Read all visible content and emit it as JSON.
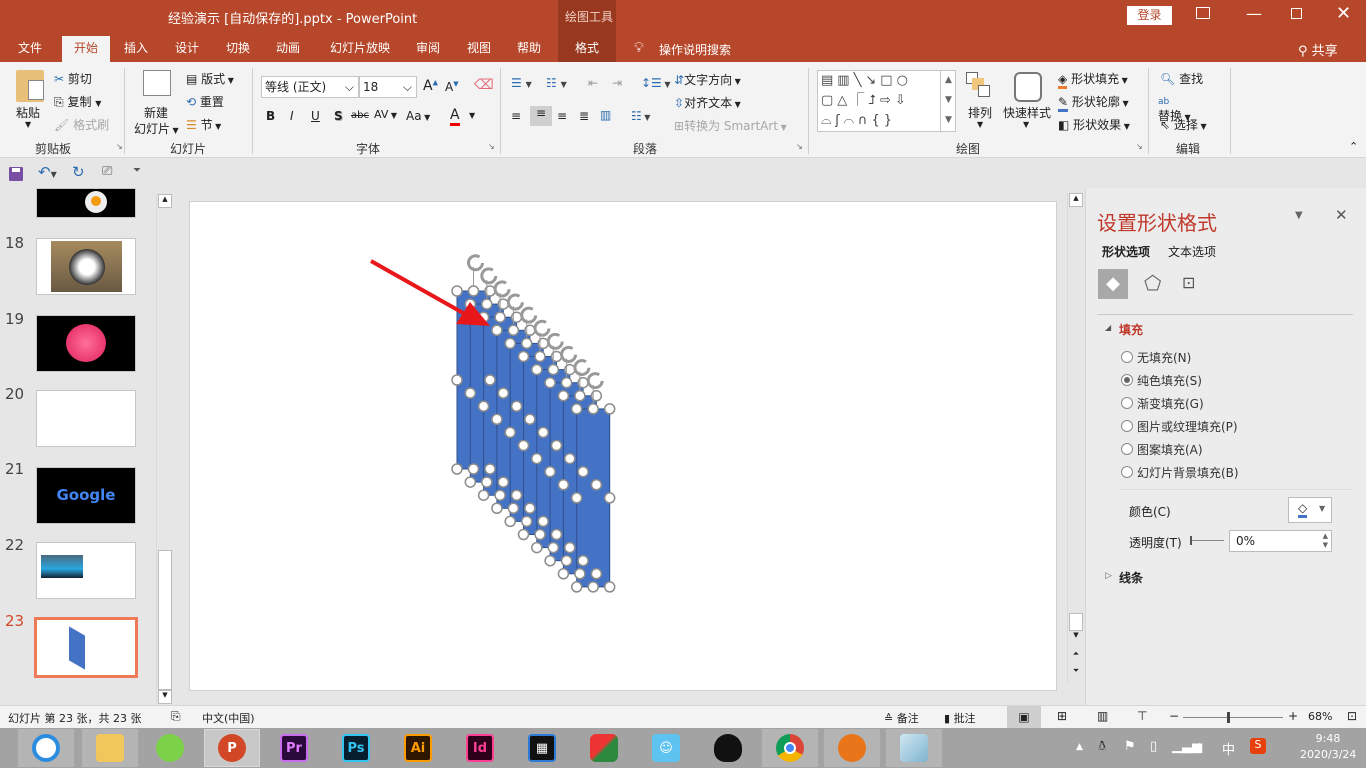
{
  "titlebar": {
    "title": "经验演示 [自动保存的].pptx  -  PowerPoint",
    "context_group": "绘图工具",
    "login": "登录",
    "share": "共享"
  },
  "tabs": [
    "文件",
    "开始",
    "插入",
    "设计",
    "切换",
    "动画",
    "幻灯片放映",
    "审阅",
    "视图",
    "帮助",
    "格式"
  ],
  "tell_me": "操作说明搜索",
  "ribbon": {
    "clipboard": {
      "label": "剪贴板",
      "paste": "粘贴",
      "cut": "剪切",
      "copy": "复制",
      "format_painter": "格式刷"
    },
    "slides": {
      "label": "幻灯片",
      "new_slide_1": "新建",
      "new_slide_2": "幻灯片",
      "layout": "版式",
      "reset": "重置",
      "section": "节"
    },
    "font": {
      "label": "字体",
      "font_name": "等线 (正文)",
      "font_size": "18",
      "bold": "B",
      "italic": "I",
      "underline": "U",
      "shadow": "S",
      "strike": "abc",
      "spacing": "AV",
      "case": "Aa",
      "color": "A"
    },
    "paragraph": {
      "label": "段落",
      "text_direction": "文字方向",
      "align_text": "对齐文本",
      "smartart": "转换为 SmartArt"
    },
    "drawing": {
      "label": "绘图",
      "arrange": "排列",
      "quick_styles": "快速样式",
      "shape_fill": "形状填充",
      "shape_outline": "形状轮廓",
      "shape_effects": "形状效果"
    },
    "editing": {
      "label": "编辑",
      "find": "查找",
      "replace": "替换",
      "select": "选择"
    }
  },
  "thumbnails": [
    {
      "num": "18"
    },
    {
      "num": "19"
    },
    {
      "num": "20"
    },
    {
      "num": "21",
      "text": "Google"
    },
    {
      "num": "22"
    },
    {
      "num": "23",
      "selected": true
    }
  ],
  "pane": {
    "title": "设置形状格式",
    "tab_shape": "形状选项",
    "tab_text": "文本选项",
    "section_fill": "填充",
    "options": [
      "无填充(N)",
      "纯色填充(S)",
      "渐变填充(G)",
      "图片或纹理填充(P)",
      "图案填充(A)",
      "幻灯片背景填充(B)"
    ],
    "selected_option": 1,
    "color_label": "颜色(C)",
    "transparency_label": "透明度(T)",
    "transparency_value": "0%",
    "section_line": "线条"
  },
  "status": {
    "slide_info": "幻灯片 第 23 张，共 23 张",
    "language": "中文(中国)",
    "notes": "备注",
    "comments": "批注",
    "zoom": "68%",
    "zoom_fraction": 0.45
  },
  "taskbar": {
    "apps": [
      "360浏览器",
      "文件资源管理器",
      "微信",
      "PowerPoint",
      "Pr",
      "Ps",
      "Ai",
      "Id",
      "视频编辑",
      "画图",
      "助手",
      "QQ",
      "Chrome",
      "Foxmail",
      "便笺"
    ],
    "time": "9:48",
    "date": "2020/3/24",
    "ime": "中"
  },
  "colors": {
    "accent": "#b7472a",
    "shape_fill": "#4472c4",
    "arrow": "#e8171a"
  }
}
